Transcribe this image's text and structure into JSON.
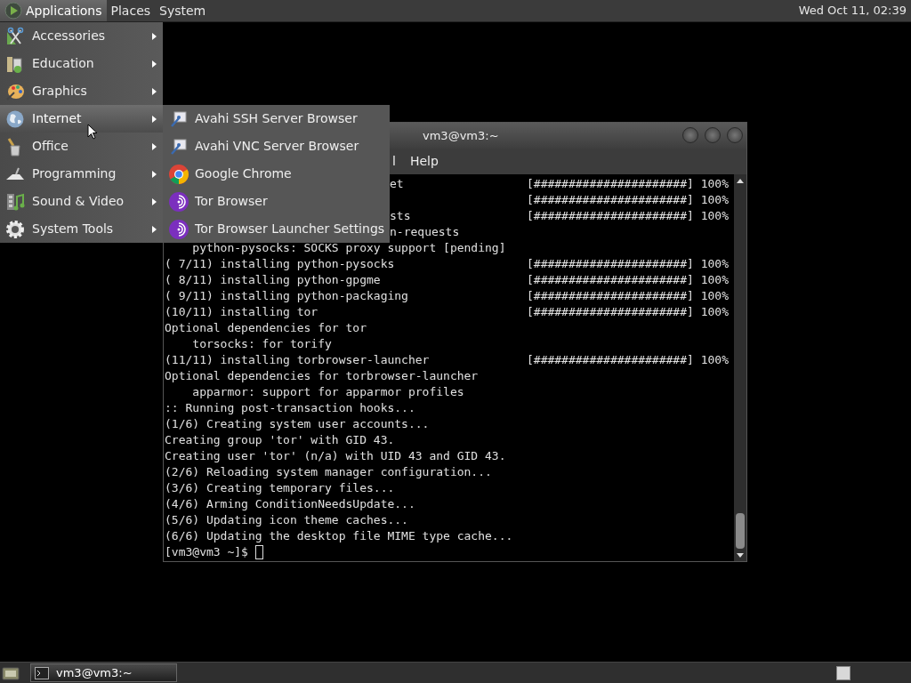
{
  "top_panel": {
    "menus": [
      {
        "label": "Applications",
        "selected": true
      },
      {
        "label": "Places",
        "selected": false
      },
      {
        "label": "System",
        "selected": false
      }
    ],
    "clock": "Wed Oct 11, 02:39"
  },
  "applications_menu": {
    "items": [
      {
        "label": "Accessories",
        "selected": false
      },
      {
        "label": "Education",
        "selected": false
      },
      {
        "label": "Graphics",
        "selected": false
      },
      {
        "label": "Internet",
        "selected": true
      },
      {
        "label": "Office",
        "selected": false
      },
      {
        "label": "Programming",
        "selected": false
      },
      {
        "label": "Sound & Video",
        "selected": false
      },
      {
        "label": "System Tools",
        "selected": false
      }
    ]
  },
  "internet_submenu": {
    "items": [
      {
        "label": "Avahi SSH Server Browser"
      },
      {
        "label": "Avahi VNC Server Browser"
      },
      {
        "label": "Google Chrome"
      },
      {
        "label": "Tor Browser"
      },
      {
        "label": "Tor Browser Launcher Settings"
      }
    ]
  },
  "terminal_window": {
    "title": "vm3@vm3:~",
    "menu": [
      "l",
      "Help"
    ],
    "lines": [
      {
        "kind": "covered",
        "text": "et",
        "progress": "[######################] 100%"
      },
      {
        "kind": "covered",
        "progress": "[######################] 100%"
      },
      {
        "kind": "covered",
        "text": "sts",
        "progress": "[######################] 100%"
      },
      {
        "kind": "covered",
        "text": "n-requests"
      },
      {
        "kind": "line",
        "text": "    python-pysocks: SOCKS proxy support [pending]"
      },
      {
        "kind": "line",
        "text": "( 7/11) installing python-pysocks",
        "progress": "[######################] 100%"
      },
      {
        "kind": "line",
        "text": "( 8/11) installing python-gpgme",
        "progress": "[######################] 100%"
      },
      {
        "kind": "line",
        "text": "( 9/11) installing python-packaging",
        "progress": "[######################] 100%"
      },
      {
        "kind": "line",
        "text": "(10/11) installing tor",
        "progress": "[######################] 100%"
      },
      {
        "kind": "line",
        "text": "Optional dependencies for tor"
      },
      {
        "kind": "line",
        "text": "    torsocks: for torify"
      },
      {
        "kind": "line",
        "text": "(11/11) installing torbrowser-launcher",
        "progress": "[######################] 100%"
      },
      {
        "kind": "line",
        "text": "Optional dependencies for torbrowser-launcher"
      },
      {
        "kind": "line",
        "text": "    apparmor: support for apparmor profiles"
      },
      {
        "kind": "line",
        "text": ":: Running post-transaction hooks..."
      },
      {
        "kind": "line",
        "text": "(1/6) Creating system user accounts..."
      },
      {
        "kind": "line",
        "text": "Creating group 'tor' with GID 43."
      },
      {
        "kind": "line",
        "text": "Creating user 'tor' (n/a) with UID 43 and GID 43."
      },
      {
        "kind": "line",
        "text": "(2/6) Reloading system manager configuration..."
      },
      {
        "kind": "line",
        "text": "(3/6) Creating temporary files..."
      },
      {
        "kind": "line",
        "text": "(4/6) Arming ConditionNeedsUpdate..."
      },
      {
        "kind": "line",
        "text": "(5/6) Updating icon theme caches..."
      },
      {
        "kind": "line",
        "text": "(6/6) Updating the desktop file MIME type cache..."
      }
    ],
    "prompt": "[vm3@vm3 ~]$"
  },
  "taskbar": {
    "tasks": [
      {
        "label": "vm3@vm3:~",
        "selected": true
      }
    ]
  }
}
